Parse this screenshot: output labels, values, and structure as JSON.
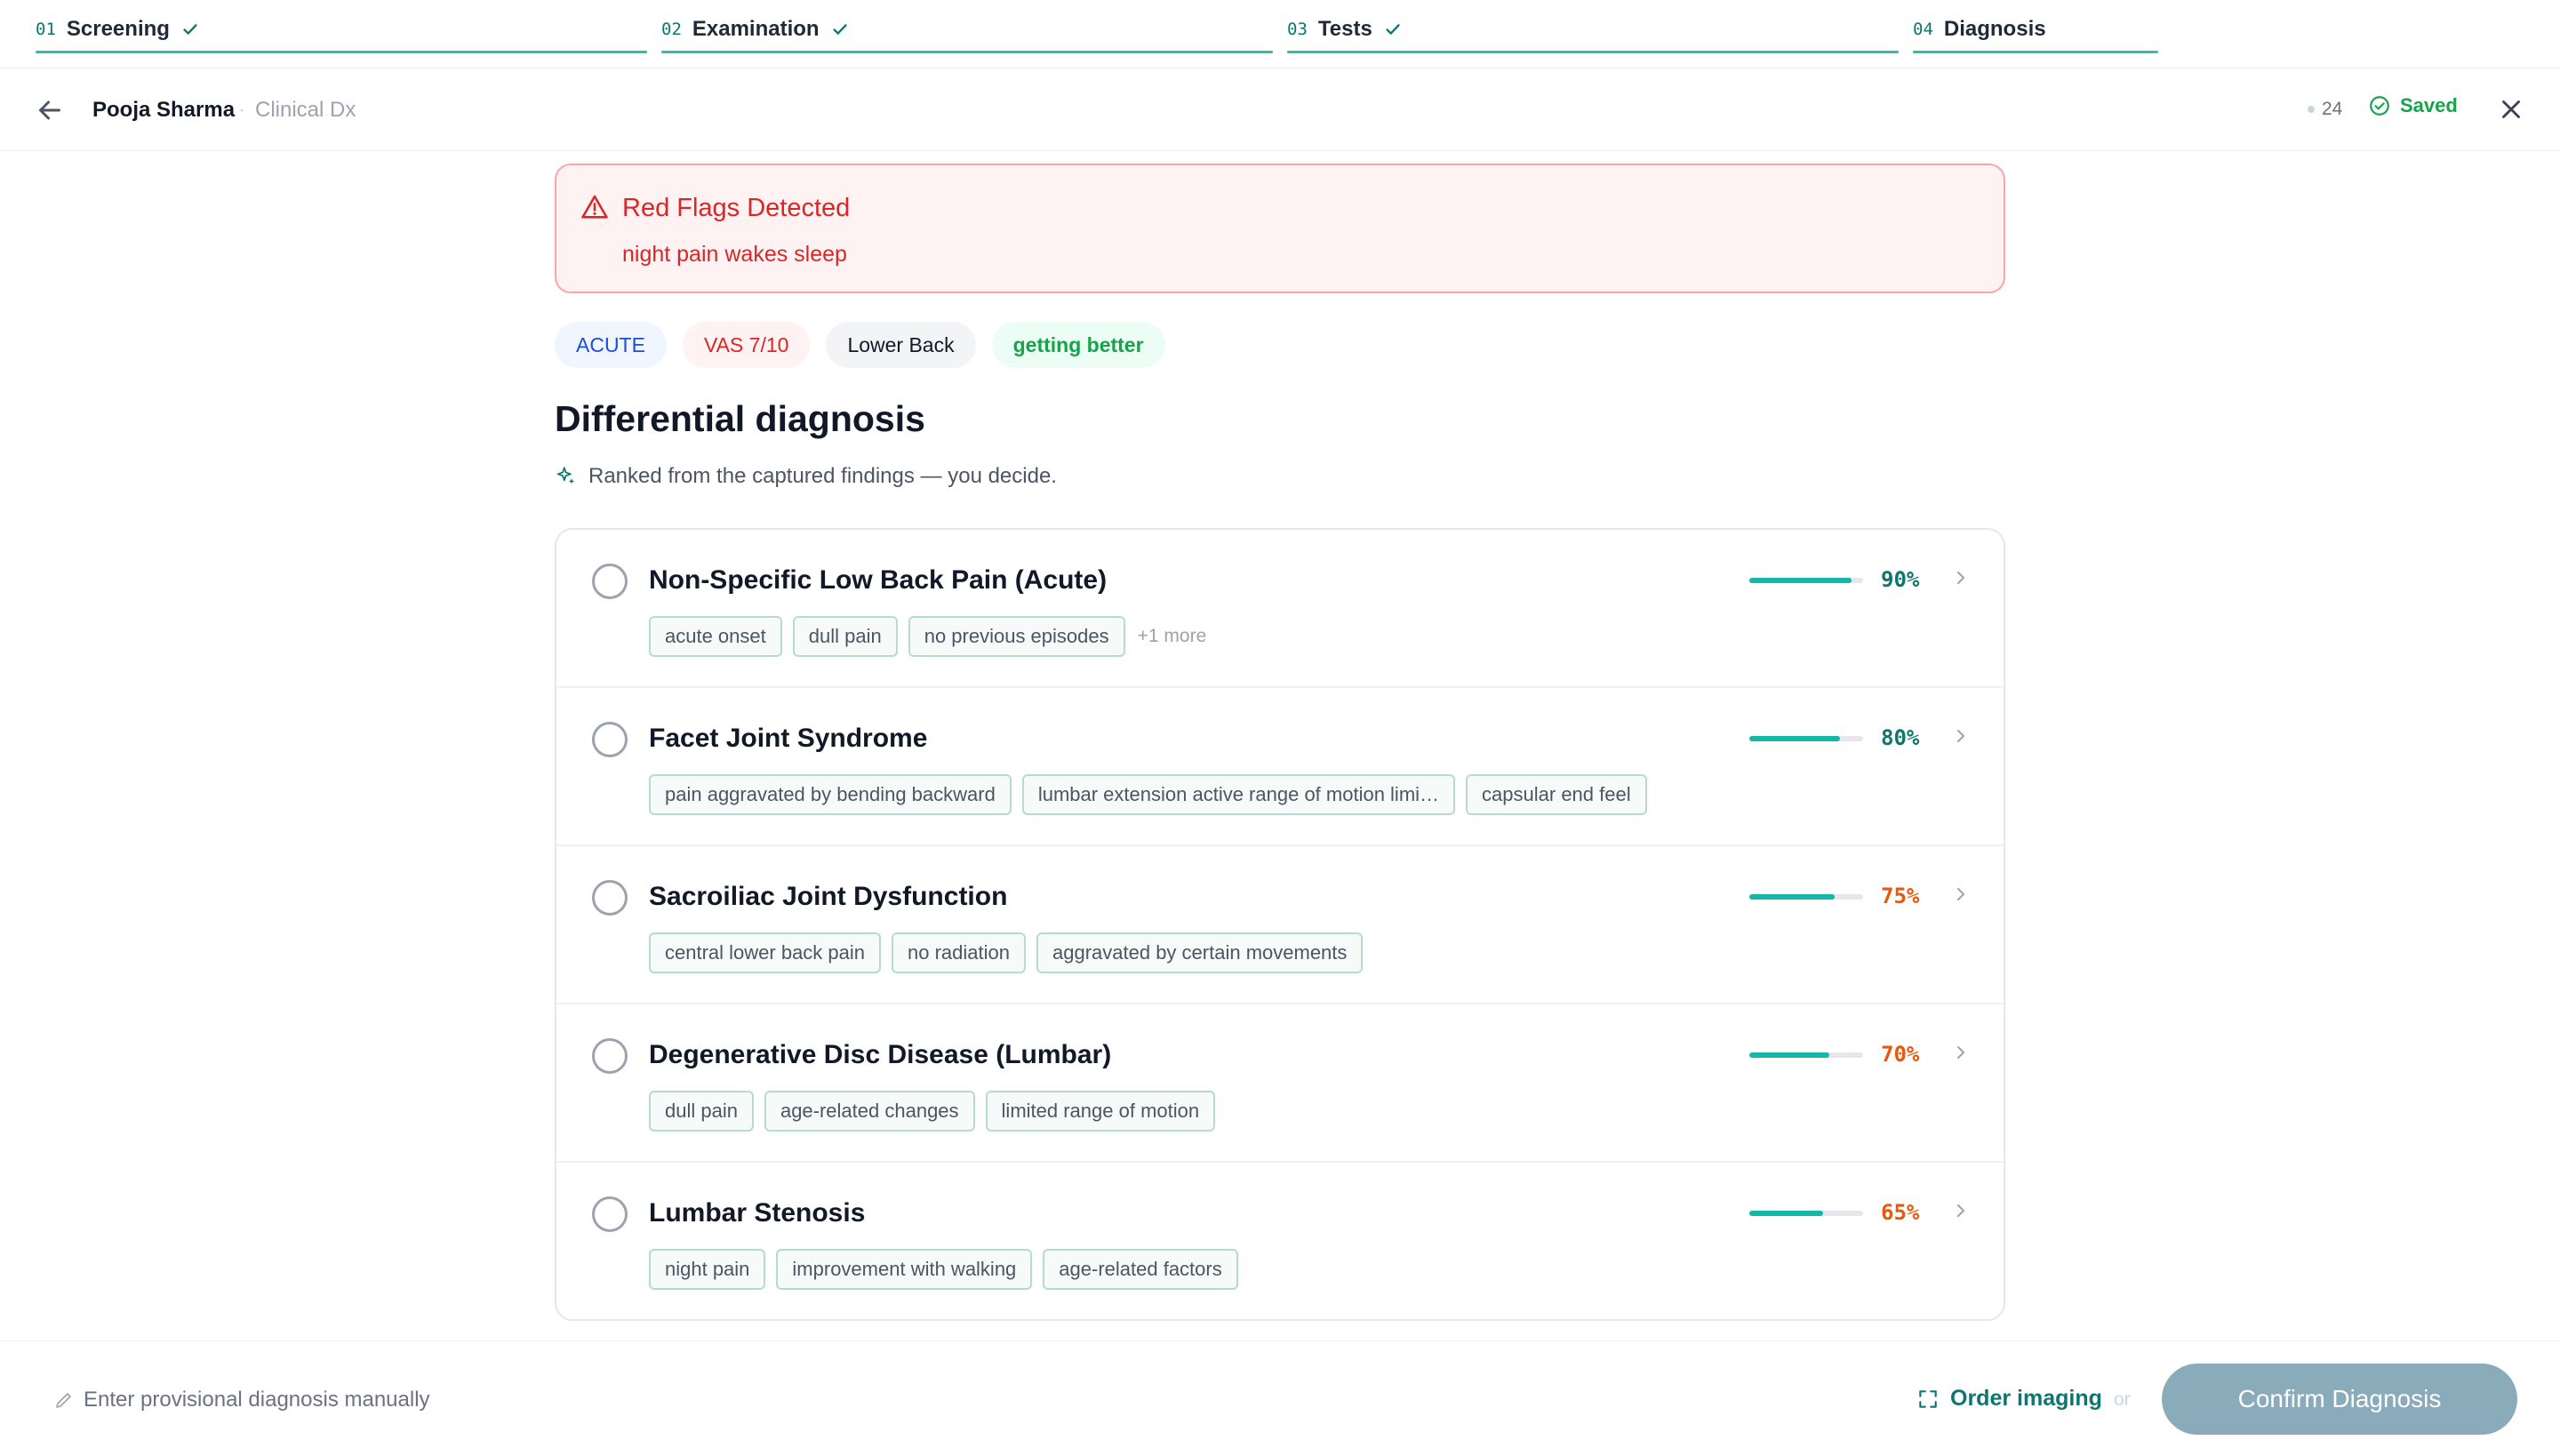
{
  "stepper": {
    "steps": [
      {
        "num": "01",
        "label": "Screening",
        "done": true
      },
      {
        "num": "02",
        "label": "Examination",
        "done": true
      },
      {
        "num": "03",
        "label": "Tests",
        "done": true
      },
      {
        "num": "04",
        "label": "Diagnosis",
        "done": false
      }
    ]
  },
  "header": {
    "patient_name": "Pooja Sharma",
    "separator": "·",
    "context": "Clinical Dx",
    "count": "24",
    "saved_label": "Saved",
    "icons": {
      "back": "arrow-left-icon",
      "saved": "check-circle-icon",
      "close": "close-icon"
    }
  },
  "alert": {
    "title": "Red Flags Detected",
    "body": "night pain wakes sleep",
    "icon": "warning-triangle-icon"
  },
  "chips": [
    {
      "label": "ACUTE",
      "tone": "blue"
    },
    {
      "label": "VAS 7/10",
      "tone": "red"
    },
    {
      "label": "Lower Back",
      "tone": "gray"
    },
    {
      "label": "getting better",
      "tone": "green"
    }
  ],
  "differential": {
    "title": "Differential diagnosis",
    "subtitle": "Ranked from the captured findings — you decide.",
    "items": [
      {
        "name": "Non-Specific Low Back Pain (Acute)",
        "score": 90,
        "score_label": "90%",
        "tags": [
          "acute onset",
          "dull pain",
          "no previous episodes"
        ],
        "more": "+1 more"
      },
      {
        "name": "Facet Joint Syndrome",
        "score": 80,
        "score_label": "80%",
        "tags": [
          "pain aggravated by bending backward",
          "lumbar extension active range of motion limi…",
          "capsular end feel"
        ],
        "more": ""
      },
      {
        "name": "Sacroiliac Joint Dysfunction",
        "score": 75,
        "score_label": "75%",
        "tags": [
          "central lower back pain",
          "no radiation",
          "aggravated by certain movements"
        ],
        "more": ""
      },
      {
        "name": "Degenerative Disc Disease (Lumbar)",
        "score": 70,
        "score_label": "70%",
        "tags": [
          "dull pain",
          "age-related changes",
          "limited range of motion"
        ],
        "more": ""
      },
      {
        "name": "Lumbar Stenosis",
        "score": 65,
        "score_label": "65%",
        "tags": [
          "night pain",
          "improvement with walking",
          "age-related factors"
        ],
        "more": ""
      }
    ]
  },
  "footer": {
    "manual_label": "Enter provisional diagnosis manually",
    "order_label": "Order imaging",
    "or_label": "or",
    "confirm_label": "Confirm Diagnosis"
  },
  "colors": {
    "accent": "#0f766e",
    "progress": "#14b8a6",
    "score_high": "#0f766e",
    "score_mid": "#ea580c",
    "danger": "#dc2626",
    "confirm_disabled": "#8aabba"
  }
}
